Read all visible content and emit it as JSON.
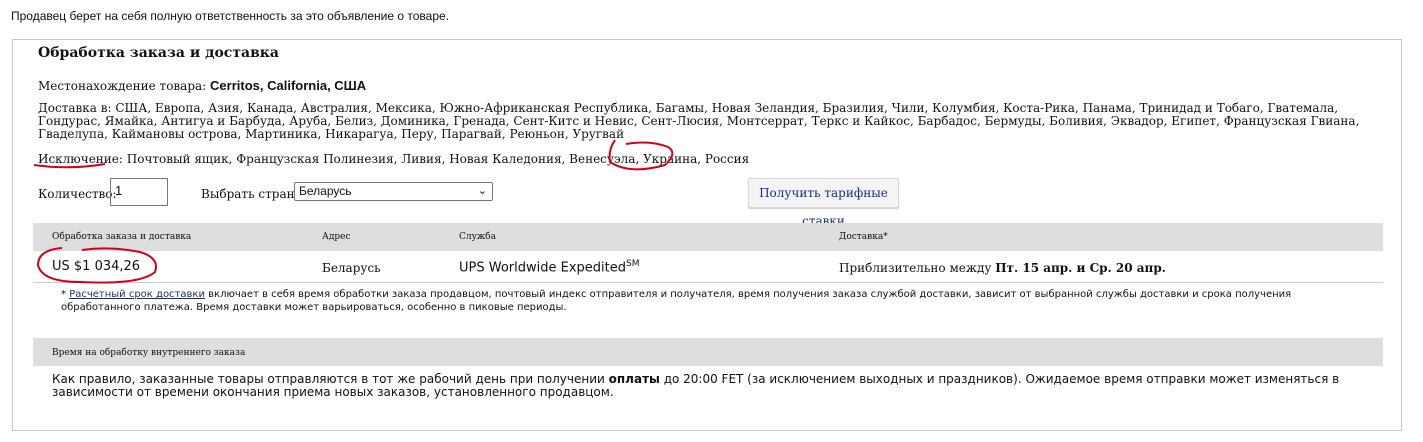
{
  "seller_note": "Продавец берет на себя полную ответственность за это объявление о товаре.",
  "section": {
    "title": "Обработка заказа и доставка",
    "location_label": "Местонахождение товара:",
    "location_value": "Cerritos, California, США",
    "ships_to_label": "Доставка в:",
    "ships_to_value": "США, Европа, Азия, Канада, Австралия, Мексика, Южно-Африканская Республика, Багамы, Новая Зеландия, Бразилия, Чили, Колумбия, Коста-Рика, Панама, Тринидад и Тобаго, Гватемала, Гондурас, Ямайка, Антигуа и Барбуда, Аруба, Белиз, Доминика, Гренада, Сент-Китс и Невис, Сент-Люсия, Монтсеррат, Теркс и Кайкос, Барбадос, Бермуды, Боливия, Эквадор, Египет, Французская Гвиана, Гваделупа, Каймановы острова, Мартиника, Никарагуа, Перу, Парагвай, Реюньон, Уругвай",
    "exclusion_label": "Исключение",
    "exclusion_value": "Почтовый ящик, Французская Полинезия, Ливия, Новая Каледония, Венесуэла, Украина, Россия"
  },
  "controls": {
    "quantity_label": "Количество:",
    "quantity_value": "1",
    "country_label": "Выбрать страну:",
    "country_selected": "Беларусь",
    "rates_button": "Получить тарифные ставки"
  },
  "table": {
    "headers": [
      "Обработка заказа и доставка",
      "Адрес",
      "Служба",
      "Доставка*"
    ],
    "row": {
      "price": "US $1 034,26",
      "address": "Беларусь",
      "service": "UPS Worldwide Expedited",
      "service_sup": "SM",
      "delivery_prefix": "Приблизительно между",
      "delivery_dates": "Пт. 15 апр. и Ср. 20 апр."
    },
    "note_link": "Расчетный срок доставки",
    "note_text": "включает в себя время обработки заказа продавцом, почтовый индекс отправителя и получателя, время получения заказа службой доставки, зависит от выбранной службы доставки и срока получения обработанного платежа. Время доставки может варьироваться, особенно в пиковые периоды."
  },
  "handling": {
    "header": "Время на обработку внутреннего заказа",
    "text_1": "Как правило, заказанные товары отправляются в тот же рабочий день при получении",
    "text_bold": "оплаты",
    "text_2": "до 20:00 FET (за исключением выходных и праздников). Ожидаемое время отправки может изменяться в зависимости от времени окончания приема новых заказов, установленного продавцом."
  },
  "colors": {
    "annotation": "#d0021b",
    "link": "#1a2d75",
    "header_bg": "#dedede"
  }
}
